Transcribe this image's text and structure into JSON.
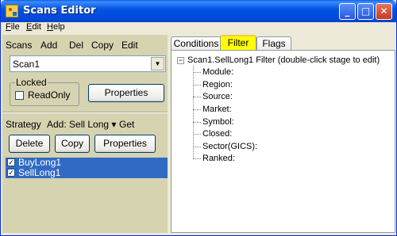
{
  "window": {
    "title": "Scans Editor"
  },
  "menu": [
    {
      "key": "F",
      "rest": "ile"
    },
    {
      "key": "E",
      "rest": "dit"
    },
    {
      "key": "H",
      "rest": "elp"
    }
  ],
  "scans_toolbar": {
    "label": "Scans",
    "add": "Add",
    "del": "Del",
    "copy": "Copy",
    "edit": "Edit"
  },
  "scan_select": {
    "value": "Scan1"
  },
  "locked_group": {
    "legend": "Locked",
    "readonly_label": "ReadOnly",
    "readonly_checked": false
  },
  "properties_button": "Properties",
  "strategy_bar": {
    "label": "Strategy",
    "add": "Add: Sell Long",
    "arrow": "▾",
    "get": "Get"
  },
  "strategy_buttons": {
    "delete": "Delete",
    "copy": "Copy",
    "properties": "Properties"
  },
  "strategies": [
    {
      "label": "BuyLong1",
      "checked": true
    },
    {
      "label": "SellLong1",
      "checked": true
    }
  ],
  "tabs": [
    {
      "label": "Conditions",
      "active": false
    },
    {
      "label": "Filter",
      "active": true
    },
    {
      "label": "Flags",
      "active": false
    }
  ],
  "filter_tree": {
    "root": "Scan1.SellLong1 Filter (double-click stage to edit)",
    "expander": "−",
    "items": [
      "Module:",
      "Region:",
      "Source:",
      "Market:",
      "Symbol:",
      "Closed:",
      "Sector(GICS):",
      "Ranked:"
    ]
  },
  "colors": {
    "title_bar": "#0454e4",
    "selection": "#316ac5",
    "active_tab": "#ffff00",
    "panel": "#d6d3b0"
  }
}
